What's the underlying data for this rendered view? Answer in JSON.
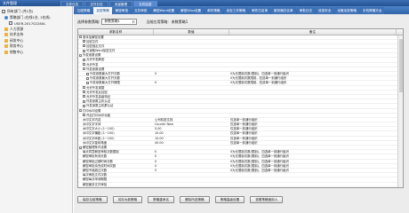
{
  "app": {
    "title": "文件管理"
  },
  "top_tabs": [
    {
      "label": "文件日志",
      "active": false
    },
    {
      "label": "文件日志",
      "active": false
    },
    {
      "label": "流量管理",
      "active": false
    },
    {
      "label": "文件加密",
      "active": true
    }
  ],
  "tree": [
    {
      "label": "所有部门 (共1台)",
      "icon": "computer-icon",
      "indent": 0
    },
    {
      "label": "策略部门 (在线1台, 1在线)",
      "icon": "group-icon",
      "indent": 3
    },
    {
      "label": "USER-20170228XL",
      "icon": "computer-icon",
      "indent": 8
    },
    {
      "label": "人力资源",
      "icon": "folder-icon",
      "indent": 3
    },
    {
      "label": "技术支持",
      "icon": "folder-icon",
      "indent": 3
    },
    {
      "label": "研发中心",
      "icon": "folder-icon",
      "indent": 3
    },
    {
      "label": "财务中心",
      "icon": "folder-icon",
      "indent": 3
    },
    {
      "label": "销售中心",
      "icon": "folder-icon",
      "indent": 3
    }
  ],
  "nav_tabs": [
    {
      "label": "加密策略",
      "active": false
    },
    {
      "label": "加密策略",
      "active": true
    },
    {
      "label": "解密审批",
      "active": false
    },
    {
      "label": "文件审批",
      "active": false
    },
    {
      "label": "解密Word设置",
      "active": false
    },
    {
      "label": "解密Winz设置",
      "active": false
    },
    {
      "label": "邮件策略",
      "active": false
    },
    {
      "label": "设定工作策略",
      "active": false
    },
    {
      "label": "邮件白名单",
      "active": false
    },
    {
      "label": "服务器白名单",
      "active": false
    },
    {
      "label": "审批日志",
      "active": false
    },
    {
      "label": "信息安全",
      "active": false
    },
    {
      "label": "设备加密策略",
      "active": false
    },
    {
      "label": "手机策略平台",
      "active": false
    }
  ],
  "filter": {
    "strategy_label": "选择参数策略:",
    "strategy_value": "参数策略1",
    "current_label": "当前应用策略:",
    "current_value": "参数策略1"
  },
  "table": {
    "headers": [
      "参数名称",
      "数值",
      "备注"
    ],
    "rows": [
      {
        "indent": 0,
        "mark": "-",
        "name": "基本加解密设置",
        "value": "",
        "note": ""
      },
      {
        "indent": 1,
        "mark": "cb",
        "name": "加密文件",
        "value": "",
        "note": ""
      },
      {
        "indent": 1,
        "mark": "cb",
        "name": "加密指定文件",
        "value": "",
        "note": ""
      },
      {
        "indent": 1,
        "mark": "cb",
        "name": "可读取Word加密文件",
        "value": "",
        "note": ""
      },
      {
        "indent": 0,
        "mark": "-",
        "name": "外发参数设置",
        "value": "",
        "note": ""
      },
      {
        "indent": 1,
        "mark": "cb",
        "name": "允许外发解密",
        "value": "",
        "note": ""
      },
      {
        "indent": 1,
        "mark": "cb",
        "name": "允许外发",
        "value": "",
        "note": ""
      },
      {
        "indent": 1,
        "mark": "-",
        "name": "外发参数设置",
        "value": "",
        "note": ""
      },
      {
        "indent": 2,
        "mark": "cb",
        "name": "外发参数最大打开次数",
        "value": "0",
        "note": "0为无限制次数(限制)，四选单一到通行组织"
      },
      {
        "indent": 2,
        "mark": "cb",
        "name": "外发参数最大打开天数",
        "value": "",
        "note": "0为无限制次数限制，四选单一到通行组织"
      },
      {
        "indent": 2,
        "mark": "cb",
        "name": "外发参数最大打开期限",
        "value": "0",
        "note": "0为无限制次数限制，四选单一到通行组织"
      },
      {
        "indent": 1,
        "mark": "cb",
        "name": "允许外发调整",
        "value": "",
        "note": ""
      },
      {
        "indent": 1,
        "mark": "cb",
        "name": "允许外发后加密",
        "value": "",
        "note": ""
      },
      {
        "indent": 1,
        "mark": "cb",
        "name": "允许外发高级特征",
        "value": "",
        "note": ""
      },
      {
        "indent": 1,
        "mark": "cb",
        "name": "外发参数主机认证",
        "value": "",
        "note": ""
      },
      {
        "indent": 1,
        "mark": "cb",
        "name": "外发参数主机群认证",
        "value": "",
        "note": ""
      },
      {
        "indent": 0,
        "mark": "-",
        "name": "打印水印设置",
        "value": "",
        "note": ""
      },
      {
        "indent": 1,
        "mark": "cb",
        "name": "开启打印水印功能",
        "value": "",
        "note": ""
      },
      {
        "indent": 1,
        "mark": "",
        "name": "水印文字内容",
        "value": "公司机密文档",
        "note": "仅选单一到通行组织"
      },
      {
        "indent": 1,
        "mark": "",
        "name": "水印文字字体",
        "value": "Courier New",
        "note": "仅选单一到通行组织"
      },
      {
        "indent": 1,
        "mark": "",
        "name": "水印文字大小 (1~100)",
        "value": "0.00",
        "note": "仅选单一到通行组织"
      },
      {
        "indent": 1,
        "mark": "",
        "name": "水印文字横距 (1~100)",
        "value": "10.00",
        "note": "仅选单一到通行组织"
      },
      {
        "indent": 1,
        "mark": "",
        "name": "水印文字纵距 (1~100)",
        "value": "10.00",
        "note": "仅选单一到通行组织"
      },
      {
        "indent": 1,
        "mark": "",
        "name": "水印文字旋转角度",
        "value": "45.00",
        "note": "仅选单一到通行组织"
      },
      {
        "indent": 0,
        "mark": "-",
        "name": "解密管理条件设置",
        "value": "",
        "note": ""
      },
      {
        "indent": 1,
        "mark": "",
        "name": "每天同意解密审核次数限制",
        "value": "0",
        "note": "0为无限制次数(限制)，四选单一到通行组织"
      },
      {
        "indent": 1,
        "mark": "",
        "name": "解密审批有效天数",
        "value": "0",
        "note": "0为无限制次数(限制)，四选单一到通行组织"
      },
      {
        "indent": 1,
        "mark": "",
        "name": "解密审批过期时间次数",
        "value": "0",
        "note": "0为无限制次数(限制)，四选单一到通行组织"
      },
      {
        "indent": 1,
        "mark": "",
        "name": "解密审批待完成时间次数",
        "value": "0",
        "note": "0为无限制次数(限制)，四选单一到通行组织"
      },
      {
        "indent": 1,
        "mark": "",
        "name": "解密不能超过次数",
        "value": "0",
        "note": "0为无限制次数(限制)，四选单一到通行组织"
      },
      {
        "indent": 1,
        "mark": "",
        "name": "每次审批文件次数",
        "value": "",
        "note": ""
      },
      {
        "indent": 1,
        "mark": "",
        "name": "解密每次申请期限",
        "value": "",
        "note": ""
      },
      {
        "indent": 1,
        "mark": "",
        "name": "解密最多文件审批",
        "value": "",
        "note": ""
      }
    ]
  },
  "buttons": {
    "save_current": "保存当前策略",
    "save_as": "另存为新策略",
    "rename": "策略重命名",
    "delete": "删除所选策略",
    "other_settings": "策略高级设置",
    "view_users": "查看策略使用人"
  }
}
